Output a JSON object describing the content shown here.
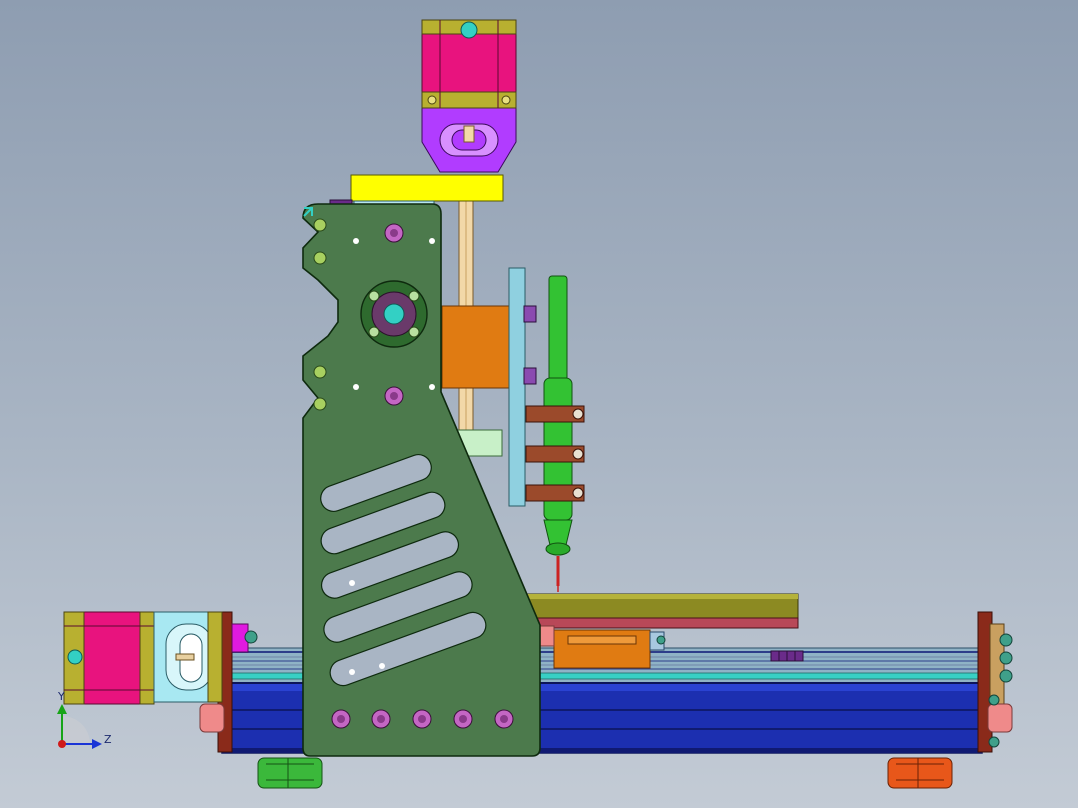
{
  "viewport": {
    "triad": {
      "y_label": "Y",
      "z_label": "Z"
    }
  },
  "colors": {
    "frame_plate": "#4c7a4c",
    "base_rail": "#1c2fb0",
    "stepper_motor": "#e8137e",
    "motor_mount": "#b13cff",
    "top_bracket": "#ffff00",
    "carriage_block": "#e07b12",
    "spindle": "#33c233",
    "clamp": "#9b4a2b",
    "bolt": "#c466c4",
    "foot_left": "#3bb83b",
    "foot_right": "#e8571a",
    "work_table": "#8c8a22"
  },
  "icons": [
    "coordinate-triad-icon"
  ]
}
